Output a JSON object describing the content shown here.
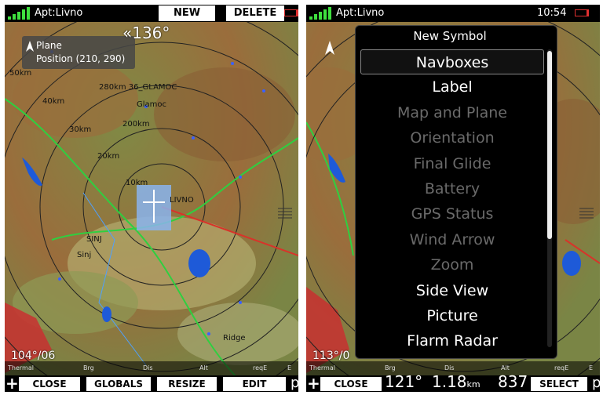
{
  "left_screen": {
    "airport": "Apt:Livno",
    "softkeys_top": [
      "NEW",
      "DELETE"
    ],
    "overlay": {
      "title": "Plane",
      "position": "Position (210, 290)"
    },
    "heading": "«136°",
    "map_labels": {
      "waypoint_1": "280km 36_GLAMOC",
      "town_1": "Glamoc",
      "waypoint_2": "SINJ",
      "town_2": "Sinj",
      "waypoint_3": "LIVNO",
      "town_3": "Ridge",
      "range_rings": [
        "50km",
        "40km",
        "30km",
        "20km",
        "10km",
        "200km"
      ]
    },
    "wind": "104°/06",
    "bottom_labels": [
      "Thermal",
      "Brg",
      "Dis",
      "Alt",
      "reqE",
      "E"
    ],
    "softkeys_bottom": [
      "CLOSE",
      "GLOBALS",
      "RESIZE",
      "EDIT"
    ],
    "plus_glyph": "+",
    "right_glyph": "p"
  },
  "right_screen": {
    "airport": "Apt:Livno",
    "time": "10:54",
    "dialog_title": "New Symbol",
    "symbols": [
      {
        "label": "Navboxes",
        "enabled": true,
        "selected": true
      },
      {
        "label": "Label",
        "enabled": true
      },
      {
        "label": "Map and Plane",
        "enabled": false
      },
      {
        "label": "Orientation",
        "enabled": false
      },
      {
        "label": "Final Glide",
        "enabled": false
      },
      {
        "label": "Battery",
        "enabled": false
      },
      {
        "label": "GPS Status",
        "enabled": false
      },
      {
        "label": "Wind Arrow",
        "enabled": false
      },
      {
        "label": "Zoom",
        "enabled": false
      },
      {
        "label": "Side View",
        "enabled": true
      },
      {
        "label": "Picture",
        "enabled": true
      },
      {
        "label": "Flarm Radar",
        "enabled": true
      }
    ],
    "wind": "113°/0",
    "bottom_labels": [
      "Thermal",
      "Brg",
      "Dis",
      "Alt",
      "reqE",
      "E"
    ],
    "values": {
      "bearing": "121°",
      "distance": "1.18",
      "distance_unit": "km",
      "altitude": "837"
    },
    "softkeys_bottom": [
      "CLOSE",
      "SELECT"
    ],
    "plus_glyph": "+",
    "right_glyph": "p"
  },
  "colors": {
    "map_green": "#8f9a55",
    "map_brown": "#9a6d3c",
    "lake_blue": "#1e5ad8",
    "track_red": "#d8332a",
    "route_green": "#2fcf40"
  }
}
